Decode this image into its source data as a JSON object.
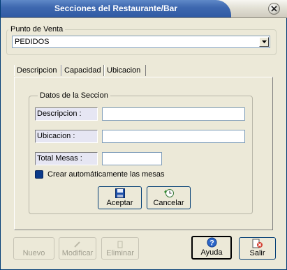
{
  "window": {
    "title": "Secciones del Restaurante/Bar"
  },
  "punto_venta": {
    "legend": "Punto de Venta",
    "selected": "PEDIDOS"
  },
  "tabs": [
    "Descripcion",
    "Capacidad",
    "Ubicacion"
  ],
  "datos": {
    "legend": "Datos de la Seccion",
    "descripcion_label": "Descripcion :",
    "descripcion_value": "",
    "ubicacion_label": "Ubicacion :",
    "ubicacion_value": "",
    "total_mesas_label": "Total Mesas :",
    "total_mesas_value": "",
    "crear_label": "Crear automáticamente las mesas"
  },
  "actions": {
    "aceptar": "Aceptar",
    "cancelar": "Cancelar"
  },
  "toolbar": {
    "nuevo": "Nuevo",
    "modificar": "Modificar",
    "eliminar": "Eliminar",
    "ayuda": "Ayuda",
    "salir": "Salir"
  },
  "icons": {
    "close": "close-icon",
    "save": "floppy-disk-icon",
    "cancel": "undo-clock-icon",
    "help": "question-icon",
    "exit": "exit-door-icon"
  },
  "colors": {
    "title_bar": "#3f69b0",
    "window_bg": "#ece9d8",
    "checkbox": "#0b3a8a"
  }
}
